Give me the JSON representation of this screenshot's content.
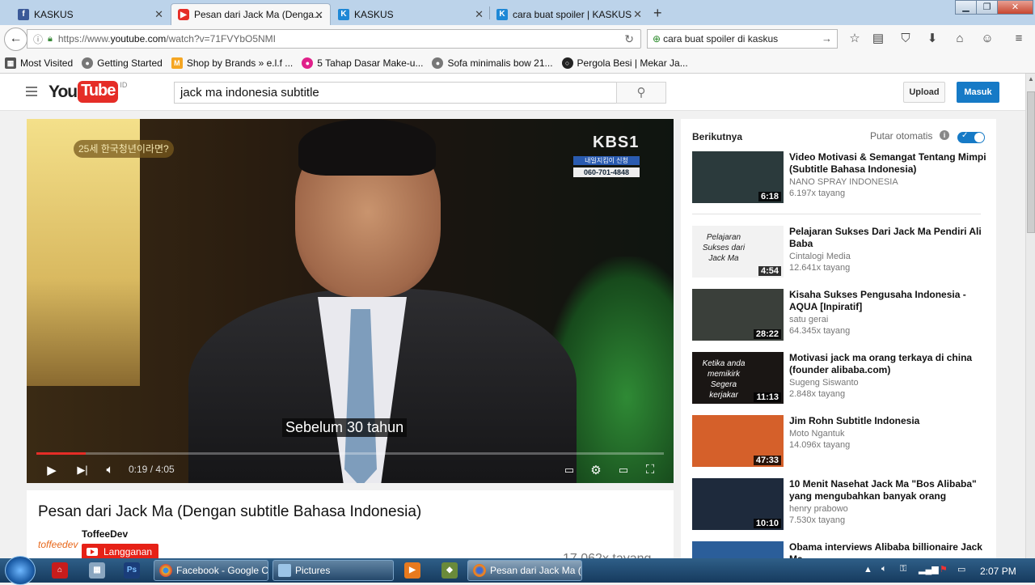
{
  "browser": {
    "tabs": [
      {
        "label": "KASKUS",
        "icon": "facebook-icon"
      },
      {
        "label": "Pesan dari Jack Ma (Denga...",
        "icon": "youtube-icon",
        "active": true
      },
      {
        "label": "KASKUS",
        "icon": "kaskus-icon"
      },
      {
        "label": "cara buat spoiler | KASKUS",
        "icon": "kaskus-icon"
      }
    ],
    "url_prefix": "https://www.",
    "url_domain": "youtube.com",
    "url_path": "/watch?v=71FVYbO5NMI",
    "search_value": "cara buat spoiler di kaskus",
    "bookmarks": [
      "Most Visited",
      "Getting Started",
      "Shop by Brands » e.l.f ...",
      "5 Tahap Dasar Make-u...",
      "Sofa minimalis bow 21...",
      "Pergola Besi | Mekar Ja..."
    ]
  },
  "youtube": {
    "logo_you": "You",
    "logo_tube": "Tube",
    "logo_region": "ID",
    "search_value": "jack ma indonesia subtitle",
    "upload_label": "Upload",
    "signin_label": "Masuk"
  },
  "player": {
    "top_caption": "25세 한국청년이라면?",
    "channel_logo": "KBS1",
    "kbs_line1": "내일지킴이 신청",
    "kbs_line2": "060-701-4848",
    "subtitle": "Sebelum 30 tahun",
    "time": "0:19 / 4:05",
    "progress": 0.078
  },
  "video": {
    "title": "Pesan dari Jack Ma (Dengan subtitle Bahasa Indonesia)",
    "channel": "ToffeeDev",
    "channel_logo_text": "toffeedev",
    "subscribe_label": "Langganan",
    "views": "17.062x tayang"
  },
  "sidebar": {
    "header": "Berikutnya",
    "autoplay_label": "Putar otomatis",
    "autoplay_on": true,
    "items": [
      {
        "title": "Video Motivasi & Semangat Tentang Mimpi (Subtitle Bahasa Indonesia)",
        "channel": "NANO SPRAY INDONESIA",
        "views": "6.197x tayang",
        "duration": "6:18",
        "thumb_color": "#2b3a3c"
      },
      {
        "title": "Pelajaran Sukses Dari Jack Ma Pendiri Ali Baba",
        "channel": "Cintalogi Media",
        "views": "12.641x tayang",
        "duration": "4:54",
        "thumb_color": "#f2f2f2",
        "thumb_text": "Pelajaran Sukses dari Jack Ma"
      },
      {
        "title": "Kisaha Sukses Pengusaha Indonesia - AQUA [Inpiratif]",
        "channel": "satu gerai",
        "views": "64.345x tayang",
        "duration": "28:22",
        "thumb_color": "#3a3f3a"
      },
      {
        "title": "Motivasi jack ma orang terkaya di china (founder alibaba.com)",
        "channel": "Sugeng Siswanto",
        "views": "2.848x tayang",
        "duration": "11:13",
        "thumb_color": "#1a1614",
        "thumb_text": "Ketika anda memikirk Segera kerjakar"
      },
      {
        "title": "Jim Rohn Subtitle Indonesia",
        "channel": "Moto Ngantuk",
        "views": "14.096x tayang",
        "duration": "47:33",
        "thumb_color": "#d5602a"
      },
      {
        "title": "10 Menit Nasehat Jack Ma \"Bos Alibaba\" yang mengubahkan banyak orang",
        "channel": "henry prabowo",
        "views": "7.530x tayang",
        "duration": "10:10",
        "thumb_color": "#1e2a3c"
      },
      {
        "title": "Obama interviews Alibaba billionaire Jack Ma",
        "channel": "",
        "views": "",
        "duration": "",
        "thumb_color": "#2b5e9a"
      }
    ]
  },
  "taskbar": {
    "tasks": [
      "Facebook - Google C...",
      "Pictures",
      "Pesan dari Jack Ma (..."
    ],
    "clock": "2:07 PM"
  }
}
